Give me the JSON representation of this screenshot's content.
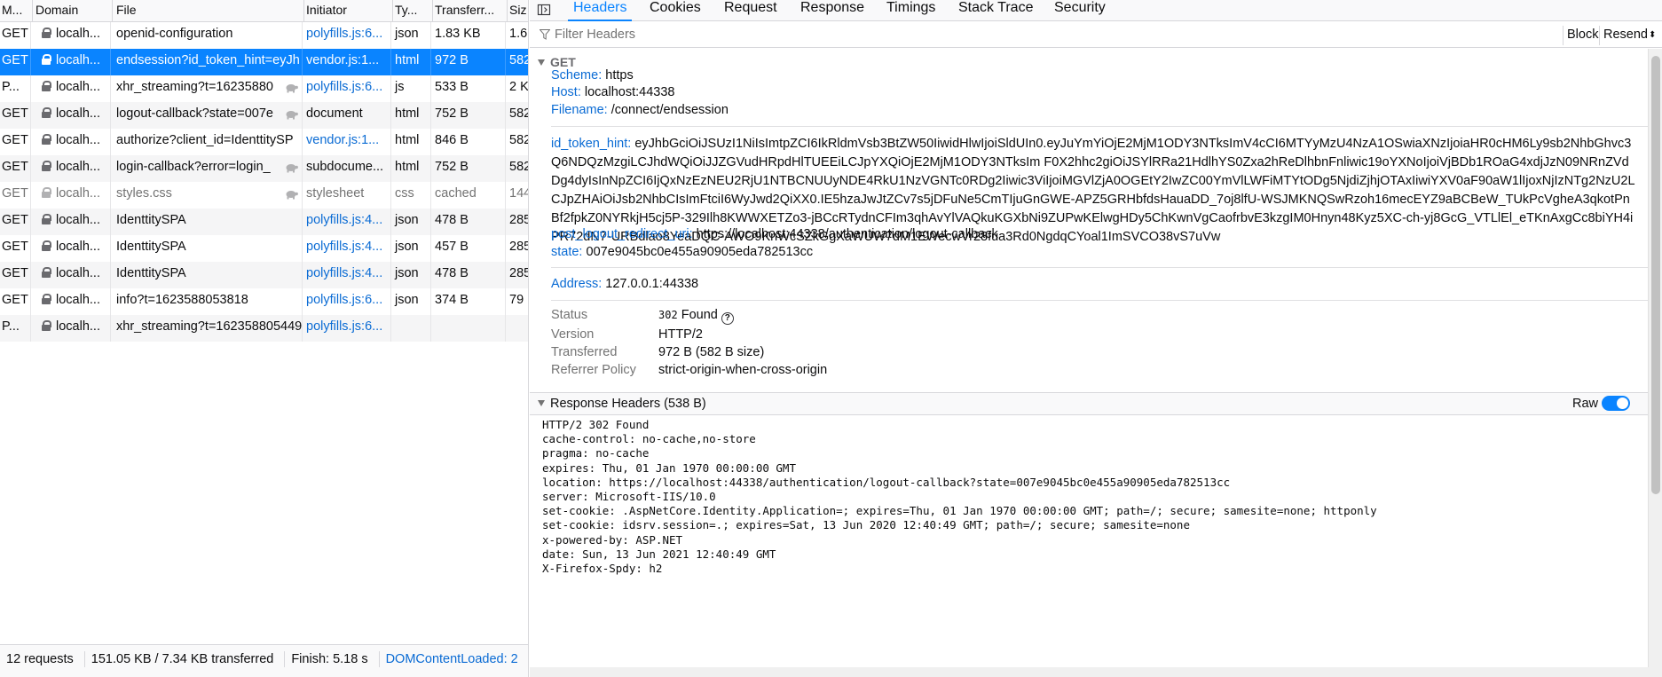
{
  "columns": [
    "M...",
    "Domain",
    "File",
    "Initiator",
    "Ty...",
    "Transferr...",
    "Siz"
  ],
  "requests": [
    {
      "method": "GET",
      "domain": "localh...",
      "file": "openid-configuration",
      "initiator": "polyfills.js:6...",
      "type": "json",
      "transferred": "1.83 KB",
      "size": "1.6",
      "selected": false,
      "muted": false,
      "turtle": false,
      "init_link": true
    },
    {
      "method": "GET",
      "domain": "localh...",
      "file": "endsession?id_token_hint=eyJh",
      "initiator": "vendor.js:1...",
      "type": "html",
      "transferred": "972 B",
      "size": "582",
      "selected": true,
      "muted": false,
      "turtle": false,
      "init_link": true
    },
    {
      "method": "P...",
      "domain": "localh...",
      "file": "xhr_streaming?t=16235880",
      "initiator": "polyfills.js:6...",
      "type": "js",
      "transferred": "533 B",
      "size": "2 K",
      "selected": false,
      "muted": false,
      "turtle": true,
      "init_link": true
    },
    {
      "method": "GET",
      "domain": "localh...",
      "file": "logout-callback?state=007e",
      "initiator": "document",
      "type": "html",
      "transferred": "752 B",
      "size": "582",
      "selected": false,
      "muted": false,
      "turtle": true,
      "init_link": false
    },
    {
      "method": "GET",
      "domain": "localh...",
      "file": "authorize?client_id=IdenttitySP",
      "initiator": "vendor.js:1...",
      "type": "html",
      "transferred": "846 B",
      "size": "582",
      "selected": false,
      "muted": false,
      "turtle": false,
      "init_link": true
    },
    {
      "method": "GET",
      "domain": "localh...",
      "file": "login-callback?error=login_",
      "initiator": "subdocume...",
      "type": "html",
      "transferred": "752 B",
      "size": "582",
      "selected": false,
      "muted": false,
      "turtle": true,
      "init_link": false
    },
    {
      "method": "GET",
      "domain": "localh...",
      "file": "styles.css",
      "initiator": "stylesheet",
      "type": "css",
      "transferred": "cached",
      "size": "144",
      "selected": false,
      "muted": true,
      "turtle": true,
      "init_link": false
    },
    {
      "method": "GET",
      "domain": "localh...",
      "file": "IdenttitySPA",
      "initiator": "polyfills.js:4...",
      "type": "json",
      "transferred": "478 B",
      "size": "285",
      "selected": false,
      "muted": false,
      "turtle": false,
      "init_link": true
    },
    {
      "method": "GET",
      "domain": "localh...",
      "file": "IdenttitySPA",
      "initiator": "polyfills.js:4...",
      "type": "json",
      "transferred": "457 B",
      "size": "285",
      "selected": false,
      "muted": false,
      "turtle": false,
      "init_link": true
    },
    {
      "method": "GET",
      "domain": "localh...",
      "file": "IdenttitySPA",
      "initiator": "polyfills.js:4...",
      "type": "json",
      "transferred": "478 B",
      "size": "285",
      "selected": false,
      "muted": false,
      "turtle": false,
      "init_link": true
    },
    {
      "method": "GET",
      "domain": "localh...",
      "file": "info?t=1623588053818",
      "initiator": "polyfills.js:6...",
      "type": "json",
      "transferred": "374 B",
      "size": "79",
      "selected": false,
      "muted": false,
      "turtle": false,
      "init_link": true
    },
    {
      "method": "P...",
      "domain": "localh...",
      "file": "xhr_streaming?t=162358805449",
      "initiator": "polyfills.js:6...",
      "type": "",
      "transferred": "",
      "size": "",
      "selected": false,
      "muted": false,
      "turtle": false,
      "init_link": true
    }
  ],
  "statusbar": {
    "requests": "12 requests",
    "sizes": "151.05 KB / 7.34 KB transferred",
    "finish": "Finish: 5.18 s",
    "dcl": "DOMContentLoaded: 2"
  },
  "tabs": [
    "Headers",
    "Cookies",
    "Request",
    "Response",
    "Timings",
    "Stack Trace",
    "Security"
  ],
  "active_tab": "Headers",
  "filter": {
    "placeholder": "Filter Headers"
  },
  "toolbar": {
    "block": "Block",
    "resend": "Resend"
  },
  "get_section": {
    "title": "GET",
    "scheme_label": "Scheme:",
    "scheme": "https",
    "host_label": "Host:",
    "host": "localhost:44338",
    "filename_label": "Filename:",
    "filename": "/connect/endsession",
    "token_label": "id_token_hint:",
    "token": "eyJhbGciOiJSUzI1NiIsImtpZCI6IkRldmVsb3BtZW50IiwidHlwIjoiSldUIn0.eyJuYmYiOjE2MjM1ODY3NTksImV4cCI6MTYyMzU4NzA1OSwiaXNzIjoiaHR0cHM6Ly9sb2NhbGhvc3Q6NDQzMzgiLCJhdWQiOiJJZGVudHRpdHlTUEEiLCJpYXQiOjE2MjM1ODY3NTksIm F0X2hhc2giOiJSYlRRa21HdlhYS0Zxa2hReDlhbnFnliwic19oYXNoIjoiVjBDb1ROaG4xdjJzN09NRnZVdDg4dyIsInNpZCI6IjQxNzEzNEU2RjU1NTBCNUUyNDE4RkU1NzVGNTc0RDg2Iiwic3ViIjoiMGVlZjA0OGEtY2IwZC00YmVlLWFiMTYtODg5NjdiZjhjOTAxIiwiYXV0aF90aW1lIjoxNjIzNTg2NzU2LCJpZHAiOiJsb2NhbCIsImFtciI6WyJwd2QiXX0.IE5hzaJwJtZCv7s5jDFuNe5CmTIjuGnGWE-APZ5GRHbfdsHauaDD_7oj8lfU-WSJMKNQSwRzoh16mecEYZ9aBCBeW_TUkPcVgheA3qkotPnBf2fpkZ0NYRkjH5cj5P-329Ilh8KWWXETZo3-jBCcRTydnCFIm3qhAvYlVAQkuKGXbNi9ZUPwKElwgHDy5ChKwnVgCaofrbvE3kzgIM0Hnyn48Kyz5XC-ch-yj8GcG_VTLlEl_eTKnAxgCc8biYH4iPR72dN7-URBdlao8YeaDQC-AWO9KnWcSZkGgXaWUW7dM1EWecwVr28fua3Rd0NgdqCYoal1ImSVCO38vS7uVw",
    "post_logout_label": "post_logout_redirect_uri:",
    "post_logout": "https://localhost:44338/authentication/logout-callback",
    "state_label": "state:",
    "state": "007e9045bc0e455a90905eda782513cc",
    "address_label": "Address:",
    "address": "127.0.0.1:44338"
  },
  "summary": {
    "status_label": "Status",
    "status_code": "302",
    "status_text": "Found",
    "version_label": "Version",
    "version": "HTTP/2",
    "transferred_label": "Transferred",
    "transferred": "972 B (582 B size)",
    "referrer_label": "Referrer Policy",
    "referrer": "strict-origin-when-cross-origin"
  },
  "response_headers": {
    "title": "Response Headers (538 B)",
    "raw_label": "Raw",
    "lines": [
      "HTTP/2 302 Found",
      "cache-control: no-cache,no-store",
      "pragma: no-cache",
      "expires: Thu, 01 Jan 1970 00:00:00 GMT",
      "location: https://localhost:44338/authentication/logout-callback?state=007e9045bc0e455a90905eda782513cc",
      "server: Microsoft-IIS/10.0",
      "set-cookie: .AspNetCore.Identity.Application=; expires=Thu, 01 Jan 1970 00:00:00 GMT; path=/; secure; samesite=none; httponly",
      "set-cookie: idsrv.session=.; expires=Sat, 13 Jun 2020 12:40:49 GMT; path=/; secure; samesite=none",
      "x-powered-by: ASP.NET",
      "date: Sun, 13 Jun 2021 12:40:49 GMT",
      "X-Firefox-Spdy: h2"
    ]
  },
  "colors": {
    "accent": "#0a84ff",
    "link": "#0a6bd4"
  }
}
